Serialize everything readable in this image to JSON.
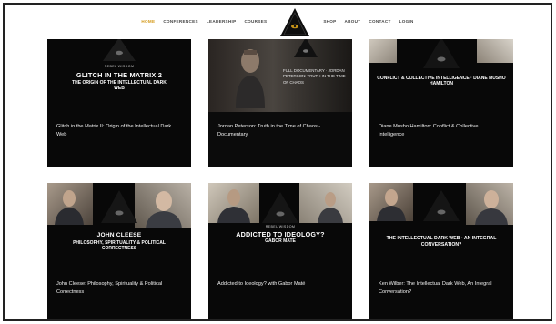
{
  "nav": {
    "left": [
      "Home",
      "Conferences",
      "Leadership",
      "Courses"
    ],
    "right": [
      "Shop",
      "About",
      "Contact",
      "Login"
    ]
  },
  "colors": {
    "accent": "#d49a1a",
    "card_bg": "#0b0b0b"
  },
  "cards": [
    {
      "tag": "Rebel Wisdom",
      "title_big": "Glitch in the Matrix 2",
      "title_sub": "The Origin of the Intellectual Dark Web",
      "caption": "Glitch in the Matrix II: Origin of the Intellectual Dark Web"
    },
    {
      "tag": "",
      "title_big": "",
      "title_sub": "Full Documentary · Jordan Peterson: Truth in the Time of Chaos",
      "caption": "Jordan Peterson: Truth in the Time of Chaos - Documentary"
    },
    {
      "tag": "",
      "title_big": "",
      "title_sub": "Conflict & Collective Intelligence · Diane Musho Hamilton",
      "caption": "Diane Musho Hamilton: Conflict & Collective Intelligence"
    },
    {
      "tag": "",
      "title_big": "John Cleese",
      "title_sub": "Philosophy, Spirituality & Political Correctness",
      "caption": "John Cleese: Philosophy, Spirituality & Political Correctness"
    },
    {
      "tag": "Rebel Wisdom",
      "title_big": "Addicted to Ideology?",
      "title_sub": "Gabor Maté",
      "caption": "Addicted to Ideology? with Gabor Maté"
    },
    {
      "tag": "",
      "title_big": "",
      "title_sub": "The Intellectual Dark Web · An Integral Conversation?",
      "caption": "Ken Wilber: The Intellectual Dark Web, An Integral Conversation?"
    }
  ]
}
